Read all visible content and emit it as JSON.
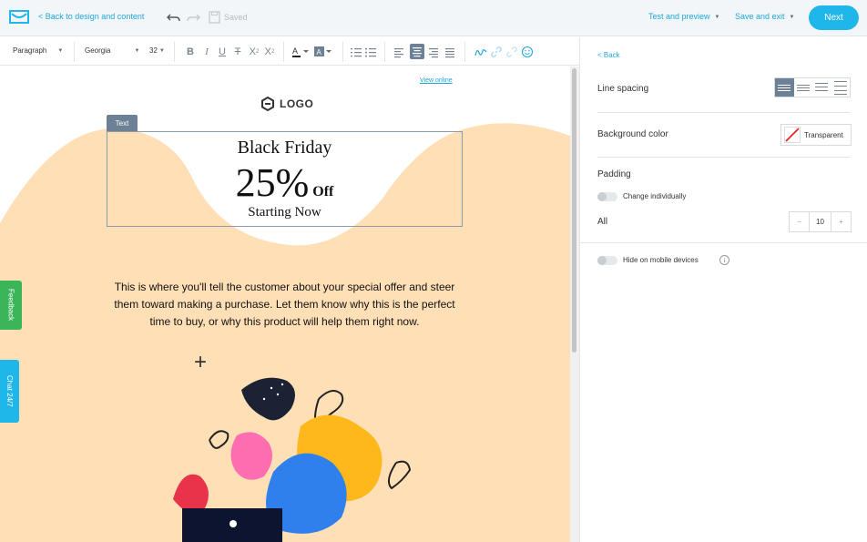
{
  "header": {
    "back_label": "< Back to design and content",
    "saved_label": "Saved",
    "test_preview_label": "Test and preview",
    "save_exit_label": "Save and exit",
    "next_label": "Next"
  },
  "toolbar": {
    "block_format": "Paragraph",
    "font_family": "Georgia",
    "font_size": "32"
  },
  "email": {
    "view_online": "View online",
    "logo_text": "LOGO",
    "selection_tag": "Text",
    "hero_title": "Black Friday",
    "hero_percent": "25%",
    "hero_off": "Off",
    "hero_subtitle": "Starting Now",
    "body_text": "This is where you'll tell the customer about your special offer and steer them toward making a purchase. Let them know why this is the perfect time to buy, or why this product will help them right now.",
    "plus": "+"
  },
  "side_tabs": {
    "feedback": "Feedback",
    "chat": "Chat 24/7"
  },
  "panel": {
    "back_label": "< Back",
    "line_spacing_label": "Line spacing",
    "background_color_label": "Background color",
    "background_value": "Transparent",
    "padding_label": "Padding",
    "change_individually_label": "Change individually",
    "all_label": "All",
    "minus": "−",
    "padding_value": "10",
    "plus": "+",
    "hide_mobile_label": "Hide on mobile devices",
    "info": "i"
  },
  "colors": {
    "accent": "#1fb6ea",
    "canvas_bg": "#ffdfb6",
    "selected": "#6c8196",
    "feedback_tab": "#3cb55a"
  }
}
